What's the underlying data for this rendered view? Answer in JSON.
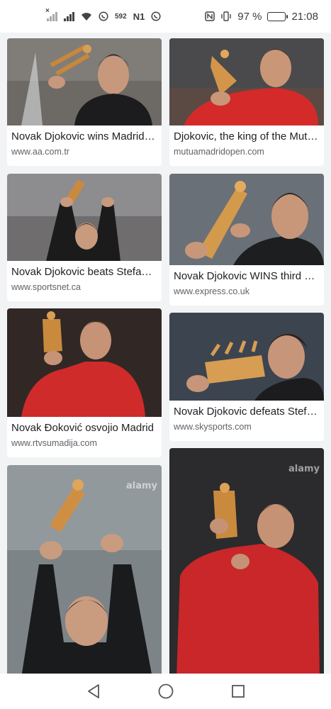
{
  "status_bar": {
    "network_left": "×",
    "operator_text": "N1",
    "speed_text": "592",
    "battery_percent": "97 %",
    "battery_level": 0.97,
    "time": "21:08"
  },
  "results": [
    {
      "title": "Novak Djokovic wins Madrid Open for third time | Tennis",
      "source": "www.aa.com.tr"
    },
    {
      "title": "Djokovic, the king of the Mutua Madrid Open",
      "source": "mutuamadridopen.com"
    },
    {
      "title": "Novak Djokovic beats Stefanos Tsitsipas",
      "source": "www.sportsnet.ca"
    },
    {
      "title": "Novak Djokovic WINS third Madrid title",
      "source": "www.express.co.uk"
    },
    {
      "title": "Novak Đoković osvojio Madrid",
      "source": "www.rtvsumadija.com"
    },
    {
      "title": "Novak Djokovic defeats Stefanos Tsitsipas",
      "source": "www.skysports.com"
    },
    {
      "title": "",
      "source": "",
      "watermark": "alamy"
    },
    {
      "title": "",
      "source": "",
      "watermark": "alamy"
    }
  ],
  "nav": {
    "back_icon": "triangle-back-icon",
    "home_icon": "circle-home-icon",
    "recents_icon": "square-recents-icon"
  }
}
